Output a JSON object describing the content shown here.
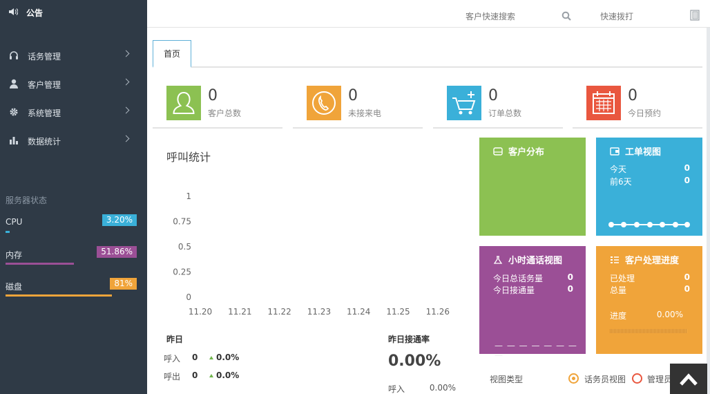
{
  "sidebar": {
    "notice": "公告",
    "items": [
      {
        "label": "话务管理",
        "icon": "headset-icon"
      },
      {
        "label": "客户管理",
        "icon": "user-icon"
      },
      {
        "label": "系统管理",
        "icon": "gear-icon"
      },
      {
        "label": "数据统计",
        "icon": "bar-chart-icon"
      }
    ],
    "status_title": "服务器状态",
    "metrics": [
      {
        "label": "CPU",
        "value": "3.20%",
        "fraction": 0.032,
        "color": "#3ab0d9"
      },
      {
        "label": "内存",
        "value": "51.86%",
        "fraction": 0.5186,
        "color": "#9b4f96"
      },
      {
        "label": "磁盘",
        "value": "81%",
        "fraction": 0.81,
        "color": "#f0a43a"
      }
    ]
  },
  "topbar": {
    "search_label": "客户快速搜索",
    "dial_label": "快速拨打"
  },
  "tabs": [
    {
      "label": "首页"
    }
  ],
  "stats": [
    {
      "value": "0",
      "label": "客户总数",
      "color": "#8cc152",
      "icon": "person-icon"
    },
    {
      "value": "0",
      "label": "未接来电",
      "color": "#f0a43a",
      "icon": "phone-icon"
    },
    {
      "value": "0",
      "label": "订单总数",
      "color": "#3ab0d9",
      "icon": "cart-icon"
    },
    {
      "value": "0",
      "label": "今日预约",
      "color": "#e9573f",
      "icon": "calendar-icon"
    }
  ],
  "call_stats": {
    "title": "呼叫统计",
    "chart_data": {
      "type": "line",
      "categories": [
        "11.20",
        "11.21",
        "11.22",
        "11.23",
        "11.24",
        "11.25",
        "11.26"
      ],
      "yticks": [
        "1",
        "0.75",
        "0.5",
        "0.25",
        "0"
      ],
      "ylim": [
        0,
        1
      ],
      "series": []
    }
  },
  "yesterday": {
    "title": "昨日",
    "rows": [
      {
        "label": "呼入",
        "value": "0",
        "change": "0.0%"
      },
      {
        "label": "呼出",
        "value": "0",
        "change": "0.0%"
      }
    ]
  },
  "connect_rate": {
    "title": "昨日接通率",
    "value": "0.00%",
    "row_label": "呼入",
    "row_value": "0.00%"
  },
  "tiles": {
    "customer_dist": {
      "title": "客户分布",
      "color": "#8cc152"
    },
    "ticket_view": {
      "title": "工单视图",
      "color": "#3ab0d9",
      "rows": [
        {
          "label": "今天",
          "value": "0"
        },
        {
          "label": "前6天",
          "value": "0"
        }
      ]
    },
    "hourly_call": {
      "title": "小时通话视图",
      "color": "#9b4f96",
      "rows": [
        {
          "label": "今日总话务量",
          "value": "0"
        },
        {
          "label": "今日接通量",
          "value": "0"
        }
      ],
      "dashes": "— — — — — — — —"
    },
    "customer_progress": {
      "title": "客户处理进度",
      "color": "#f0a43a",
      "rows": [
        {
          "label": "已处理",
          "value": "0"
        },
        {
          "label": "总量",
          "value": "0"
        }
      ],
      "progress_label": "进度",
      "progress_value": "0.00%"
    }
  },
  "view_type": {
    "label": "视图类型",
    "options": [
      {
        "label": "话务员视图",
        "selected": true
      },
      {
        "label": "管理员",
        "selected": false
      }
    ]
  }
}
